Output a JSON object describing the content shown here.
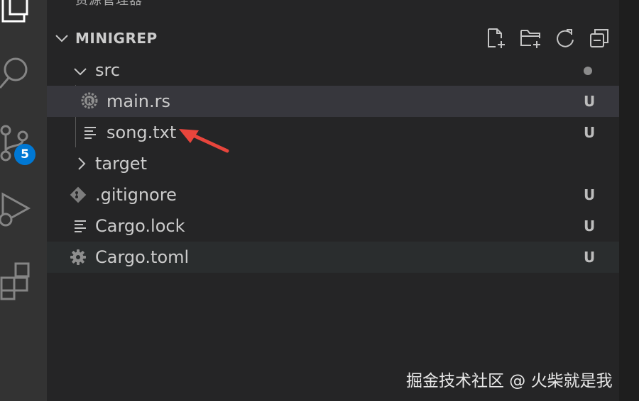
{
  "explorer": {
    "view_title": "资源管理器",
    "section_title": "MINIGREP",
    "actions": [
      "new-file",
      "new-folder",
      "refresh",
      "collapse-all"
    ]
  },
  "source_control": {
    "badge_count": "5"
  },
  "tree": {
    "src": {
      "label": "src"
    },
    "main_rs": {
      "label": "main.rs",
      "status": "U"
    },
    "song_txt": {
      "label": "song.txt",
      "status": "U"
    },
    "target": {
      "label": "target"
    },
    "gitignore": {
      "label": ".gitignore",
      "status": "U"
    },
    "cargo_lock": {
      "label": "Cargo.lock",
      "status": "U"
    },
    "cargo_toml": {
      "label": "Cargo.toml",
      "status": "U"
    }
  },
  "watermark": "掘金技术社区 @ 火柴就是我",
  "colors": {
    "activity_bar": "#333333",
    "sidebar": "#252526",
    "selected_row": "#37373d",
    "badge": "#0078d4",
    "annotation_arrow": "#e8453c"
  }
}
